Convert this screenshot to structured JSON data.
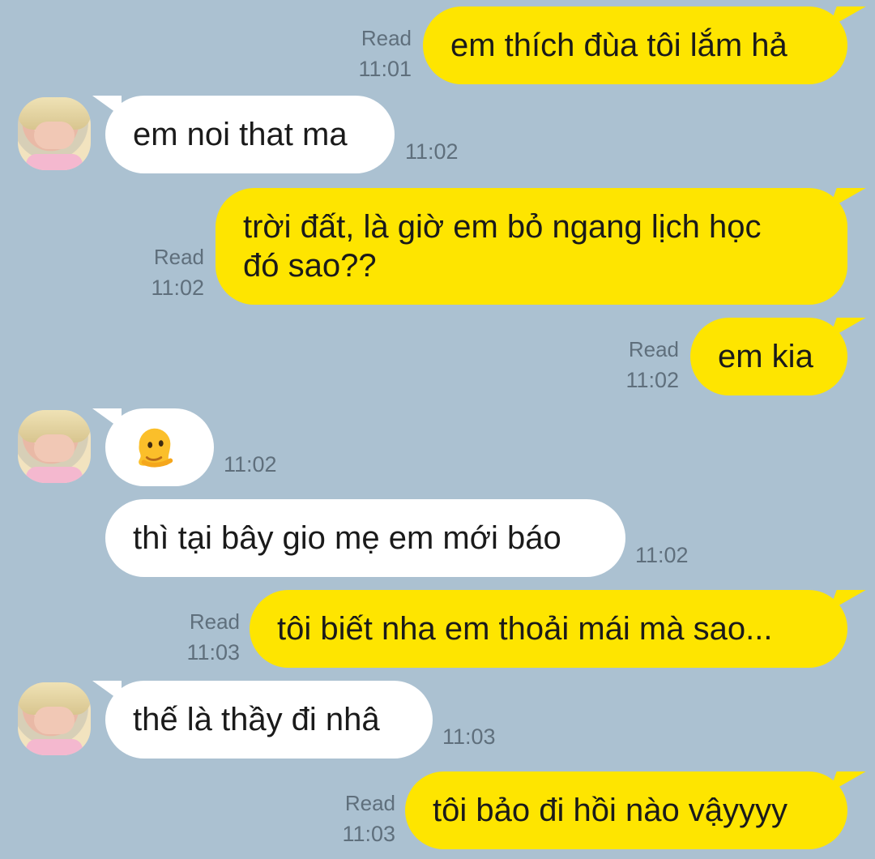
{
  "chat": {
    "read_label": "Read",
    "messages": [
      {
        "dir": "out",
        "text": "em thích đùa tôi lắm hả",
        "time": "11:01",
        "read": true
      },
      {
        "dir": "in",
        "text": "em noi that ma",
        "time": "11:02",
        "avatar": true
      },
      {
        "dir": "out",
        "text": "trời đất, là giờ em bỏ ngang lịch học\nđó sao??",
        "time": "11:02",
        "read": true
      },
      {
        "dir": "out",
        "text": "em kia",
        "time": "11:02",
        "read": true
      },
      {
        "dir": "in",
        "emoji": "melting-face-icon",
        "time": "11:02",
        "avatar": true
      },
      {
        "dir": "in",
        "text": "thì tại bây gio mẹ em mới báo",
        "time": "11:02"
      },
      {
        "dir": "out",
        "text": "tôi biết nha em thoải mái mà sao...",
        "time": "11:03",
        "read": true
      },
      {
        "dir": "in",
        "text": "thế là thầy đi nhâ",
        "time": "11:03",
        "avatar": true
      },
      {
        "dir": "out",
        "text": "tôi bảo đi hồi nào vậyyyy",
        "time": "11:03",
        "read": true
      }
    ]
  },
  "colors": {
    "background": "#abc1d1",
    "outgoing_bubble": "#fee500",
    "incoming_bubble": "#ffffff",
    "meta_text": "#5f6f7c"
  }
}
